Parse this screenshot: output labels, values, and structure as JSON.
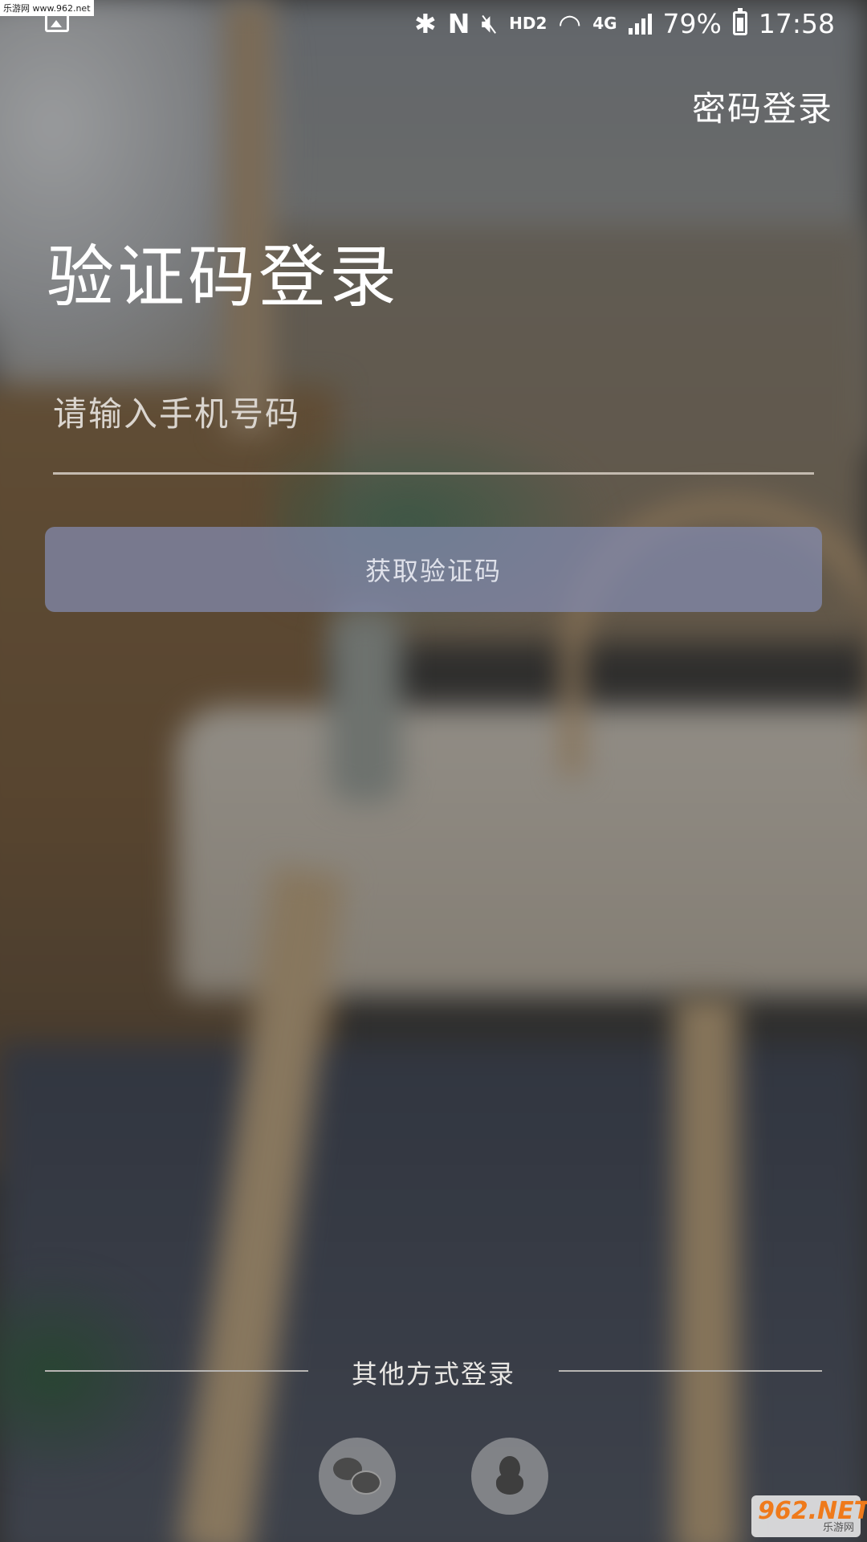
{
  "status_bar": {
    "battery_percent": "79%",
    "time": "17:58",
    "hd_label": "HD2",
    "network_label": "4G"
  },
  "watermark": {
    "top": "乐游网 www.962.net",
    "bottom_brand": "962.NET",
    "bottom_sub": "乐游网"
  },
  "header": {
    "password_login_link": "密码登录"
  },
  "main": {
    "title": "验证码登录",
    "phone_placeholder": "请输入手机号码",
    "phone_value": "",
    "get_code_button": "获取验证码"
  },
  "footer": {
    "other_methods_label": "其他方式登录",
    "social_icons": [
      "wechat-icon",
      "qq-icon"
    ]
  },
  "colors": {
    "button_bg": "#848cb2",
    "text": "#ffffff",
    "underline": "#c4bbb0"
  }
}
